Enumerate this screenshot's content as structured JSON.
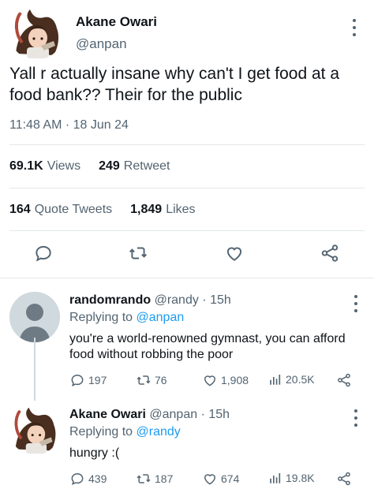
{
  "main_tweet": {
    "author_name": "Akane Owari",
    "author_handle": "@anpan",
    "text": "Yall r actually insane why can't I get food at a food bank?? Their for the public",
    "timestamp": "11:48 AM · 18 Jun 24",
    "stats": {
      "views_count": "69.1K",
      "views_label": "Views",
      "retweets_count": "249",
      "retweets_label": "Retweet",
      "quotes_count": "164",
      "quotes_label": "Quote Tweets",
      "likes_count": "1,849",
      "likes_label": "Likes"
    },
    "actions": [
      "reply-icon",
      "retweet-icon",
      "like-icon",
      "share-icon"
    ]
  },
  "replies": [
    {
      "author_name": "randomrando",
      "author_handle": "@randy",
      "time": "15h",
      "replying_label": "Replying to",
      "replying_handle": "@anpan",
      "text": "you're a world-renowned gymnast, you can afford food without robbing the poor",
      "reply_count": "197",
      "retweet_count": "76",
      "like_count": "1,908",
      "view_count": "20.5K"
    },
    {
      "author_name": "Akane Owari",
      "author_handle": "@anpan",
      "time": "15h",
      "replying_label": "Replying to",
      "replying_handle": "@randy",
      "text": "hungry :(",
      "reply_count": "439",
      "retweet_count": "187",
      "like_count": "674",
      "view_count": "19.8K"
    }
  ],
  "colors": {
    "accent": "#1d9bf0",
    "text": "#0f1419",
    "muted": "#536471",
    "divider": "#e4e8eb"
  }
}
